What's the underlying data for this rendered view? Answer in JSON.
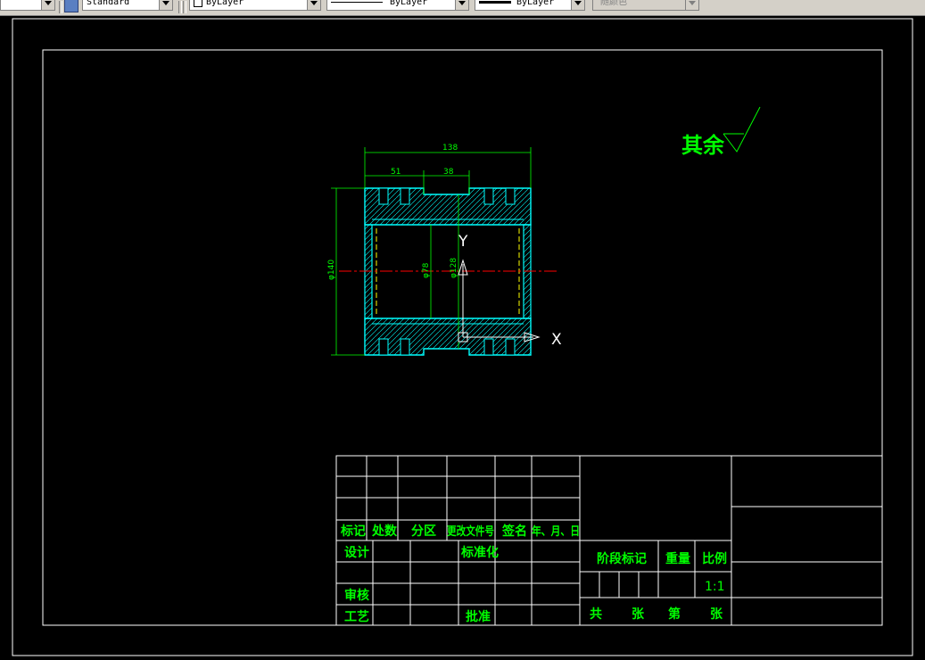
{
  "toolbar": {
    "first_combo_label": "",
    "text_style": "Standard",
    "layer": "ByLayer",
    "linetype": "ByLayer",
    "lineweight": "ByLayer",
    "plot_style": "随颜色"
  },
  "drawing": {
    "roughness_note": "其余",
    "dims": {
      "overall_length": "138",
      "left_offset": "51",
      "groove_width": "38",
      "outer_diameter": "φ140",
      "bore_diameter": "φ78",
      "mid_diameter": "φ128"
    },
    "ucs": {
      "y_label": "Y",
      "x_label": "X"
    }
  },
  "title_block": {
    "rev_headers": [
      "标记",
      "处数",
      "分区",
      "更改文件号",
      "签名",
      "年、月、日"
    ],
    "design": "设计",
    "standardize": "标准化",
    "review": "审核",
    "process": "工艺",
    "approve": "批准",
    "stage_mark": "阶段标记",
    "weight": "重量",
    "scale_label": "比例",
    "scale_value": "1:1",
    "total": "共",
    "sheets": "张",
    "sheet_no": "第",
    "sheets2": "张"
  },
  "colors": {
    "background": "#000000",
    "border": "#ffffff",
    "annotation": "#00ff00",
    "part": "#00ffff",
    "centerline": "#ff0000",
    "hidden": "#ffff00"
  }
}
